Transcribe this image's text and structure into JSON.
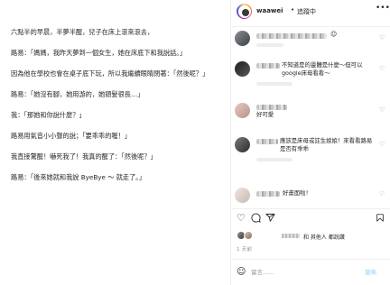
{
  "story": [
    "六點半的早晨，半夢半醒，兒子在床上滾來滾去，",
    "路易：「媽媽，我昨天夢到一個女生，她在床底下和我說話。」",
    "因為他在學校也會在桌子底下玩，所以我繼續眼睛閉著：「然後呢？」",
    "路易：「她沒有腳，她用游的，她頭髮很長…」",
    "我：「那她和你說什麼？」",
    "路易用氣音小小聲的說；「要乖乖的喔！」",
    "我直接驚醒！嚇死我了！我真的醒了：「然後呢？」",
    "路易：「後來她就和我說 ByeBye ～ 就走了。」"
  ],
  "header": {
    "username": "waawei",
    "dot": "•",
    "follow_status": "追蹤中",
    "more_icon": "more-horizontal-icon"
  },
  "comments": [
    {
      "text": "",
      "trailing_icon": "smile-emoji",
      "meta": ""
    },
    {
      "text": "不知道是的靈體是什麼～但可以google床母看看～",
      "meta": ""
    },
    {
      "text": "好可愛",
      "meta": ""
    },
    {
      "text": "應該是床母或註生娘娘！來看看路易是否有乖乖",
      "meta": ""
    },
    {
      "text": "好畫面啦！",
      "meta": ""
    }
  ],
  "actions": {
    "like_icon": "heart-icon",
    "comment_icon": "comment-icon",
    "share_icon": "send-icon",
    "save_icon": "bookmark-icon"
  },
  "likes": {
    "text": "和 其他人 都說讚"
  },
  "date": "1 天前",
  "add_comment": {
    "emoji_icon": "emoji-icon",
    "placeholder": "留言......",
    "post_label": "發佈"
  },
  "colors": {
    "text": "#262626",
    "muted": "#8e8e8e",
    "divider": "#efefef",
    "post_button_disabled": "#b2dffc"
  }
}
